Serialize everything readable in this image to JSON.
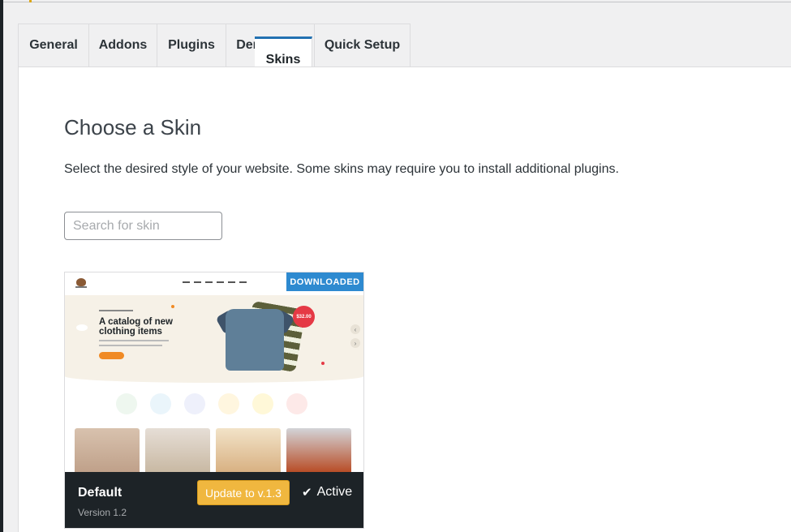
{
  "tabs": [
    {
      "label": "General"
    },
    {
      "label": "Addons"
    },
    {
      "label": "Skins"
    },
    {
      "label": "Plugins"
    },
    {
      "label": "Demo Data"
    },
    {
      "label": "Quick Setup"
    }
  ],
  "active_tab": "Skins",
  "page": {
    "title": "Choose a Skin",
    "description": "Select the desired style of your website. Some skins may require you to install additional plugins."
  },
  "search": {
    "value": "",
    "placeholder": "Search for skin"
  },
  "skins": [
    {
      "name": "Default",
      "version": "Version 1.2",
      "badge": "DOWNLOADED",
      "update_label": "Update to v.1.3",
      "status": "Active",
      "status_icon": "checkmark-icon",
      "preview": {
        "hero_title": "A catalog of new clothing items",
        "price": "$32.00"
      }
    }
  ],
  "colors": {
    "accent": "#2271b1",
    "badge": "#2e8ad0",
    "update_button": "#f0b73f",
    "card_footer": "#1d2327"
  }
}
